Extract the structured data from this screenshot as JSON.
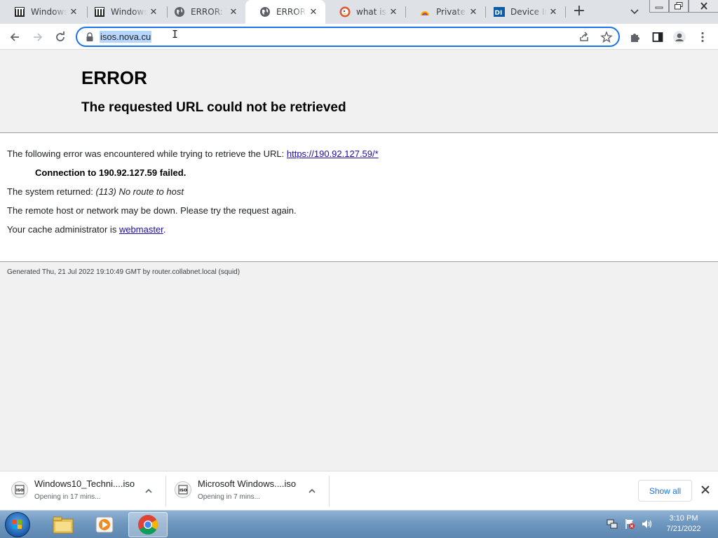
{
  "tabs": [
    {
      "title": "Windows",
      "favicon": "archive-icon"
    },
    {
      "title": "Windows",
      "favicon": "archive-icon"
    },
    {
      "title": "ERROR: T",
      "favicon": "globe-icon"
    },
    {
      "title": "ERROR: T",
      "favicon": "globe-icon"
    },
    {
      "title": "what is n",
      "favicon": "duckduckgo-icon"
    },
    {
      "title": "Private.sh",
      "favicon": "private-sh-icon"
    },
    {
      "title": "Device In",
      "favicon": "device-info-icon"
    }
  ],
  "address_bar": {
    "url": "isos.nova.cu"
  },
  "error_page": {
    "title": "ERROR",
    "subtitle": "The requested URL could not be retrieved",
    "intro_text": "The following error was encountered while trying to retrieve the URL: ",
    "intro_link": "https://190.92.127.59/*",
    "connection_failed": "Connection to 190.92.127.59 failed.",
    "system_returned_label": "The system returned: ",
    "system_returned_value": "(113) No route to host",
    "remote_down": "The remote host or network may be down. Please try the request again.",
    "cache_admin_text": "Your cache administrator is ",
    "cache_admin_link": "webmaster",
    "cache_admin_suffix": ".",
    "generated": "Generated Thu, 21 Jul 2022 19:10:49 GMT by router.collabnet.local (squid)"
  },
  "downloads": [
    {
      "filename": "Windows10_Techni....iso",
      "status": "Opening in 17 mins...",
      "icon": "iso-file-icon"
    },
    {
      "filename": "Microsoft Windows....iso",
      "status": "Opening in 7 mins...",
      "icon": "iso-file-icon"
    }
  ],
  "download_shelf": {
    "show_all_label": "Show all"
  },
  "taskbar": {
    "apps": [
      "file-explorer-icon",
      "media-player-icon",
      "chrome-icon"
    ],
    "time": "3:10 PM",
    "date": "7/21/2022"
  },
  "colors": {
    "accent": "#1a73e8",
    "link": "#1a0dab",
    "url_selection": "#b6d7fb"
  }
}
